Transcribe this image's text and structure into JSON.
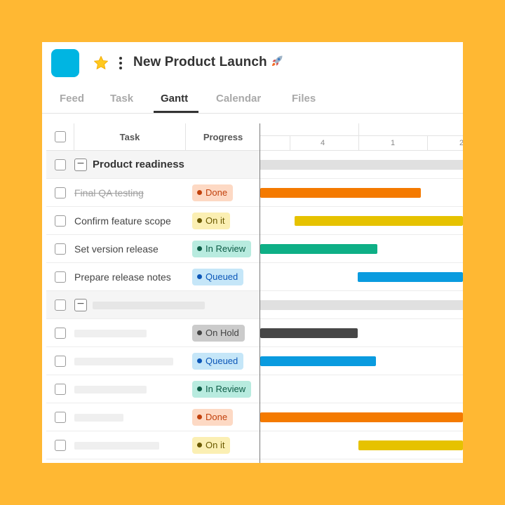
{
  "header": {
    "title": "New Product Launch"
  },
  "tabs": [
    {
      "label": "Feed"
    },
    {
      "label": "Task"
    },
    {
      "label": "Gantt"
    },
    {
      "label": "Calendar"
    },
    {
      "label": "Files"
    }
  ],
  "active_tab": "Gantt",
  "table": {
    "columns": {
      "task": "Task",
      "progress": "Progress"
    },
    "groups": [
      {
        "name": "Product readiness",
        "tasks": [
          {
            "name": "Final QA testing",
            "status": "Done"
          },
          {
            "name": "Confirm feature scope",
            "status": "On it"
          },
          {
            "name": "Set version release",
            "status": "In Review"
          },
          {
            "name": "Prepare release notes",
            "status": "Queued"
          }
        ]
      },
      {
        "name": "",
        "tasks": [
          {
            "name": "",
            "status": "On Hold"
          },
          {
            "name": "",
            "status": "Queued"
          },
          {
            "name": "",
            "status": "In Review"
          },
          {
            "name": "",
            "status": "Done"
          },
          {
            "name": "",
            "status": "On it"
          }
        ]
      }
    ]
  },
  "timeline": {
    "ticks": [
      "4",
      "1",
      "2"
    ]
  },
  "status_colors": {
    "Done": {
      "bg": "#FDD9C4",
      "dot": "#C2410C",
      "bar": "#F47A00"
    },
    "On it": {
      "bg": "#FBEFB3",
      "dot": "#6B5A00",
      "bar": "#E6C200"
    },
    "In Review": {
      "bg": "#B8EBDF",
      "dot": "#0C5C46",
      "bar": "#0EAF86"
    },
    "Queued": {
      "bg": "#C5E6F8",
      "dot": "#0B56B8",
      "bar": "#0A9BDF"
    },
    "On Hold": {
      "bg": "#CBCBCB",
      "dot": "#444444",
      "bar": "#474747"
    }
  }
}
